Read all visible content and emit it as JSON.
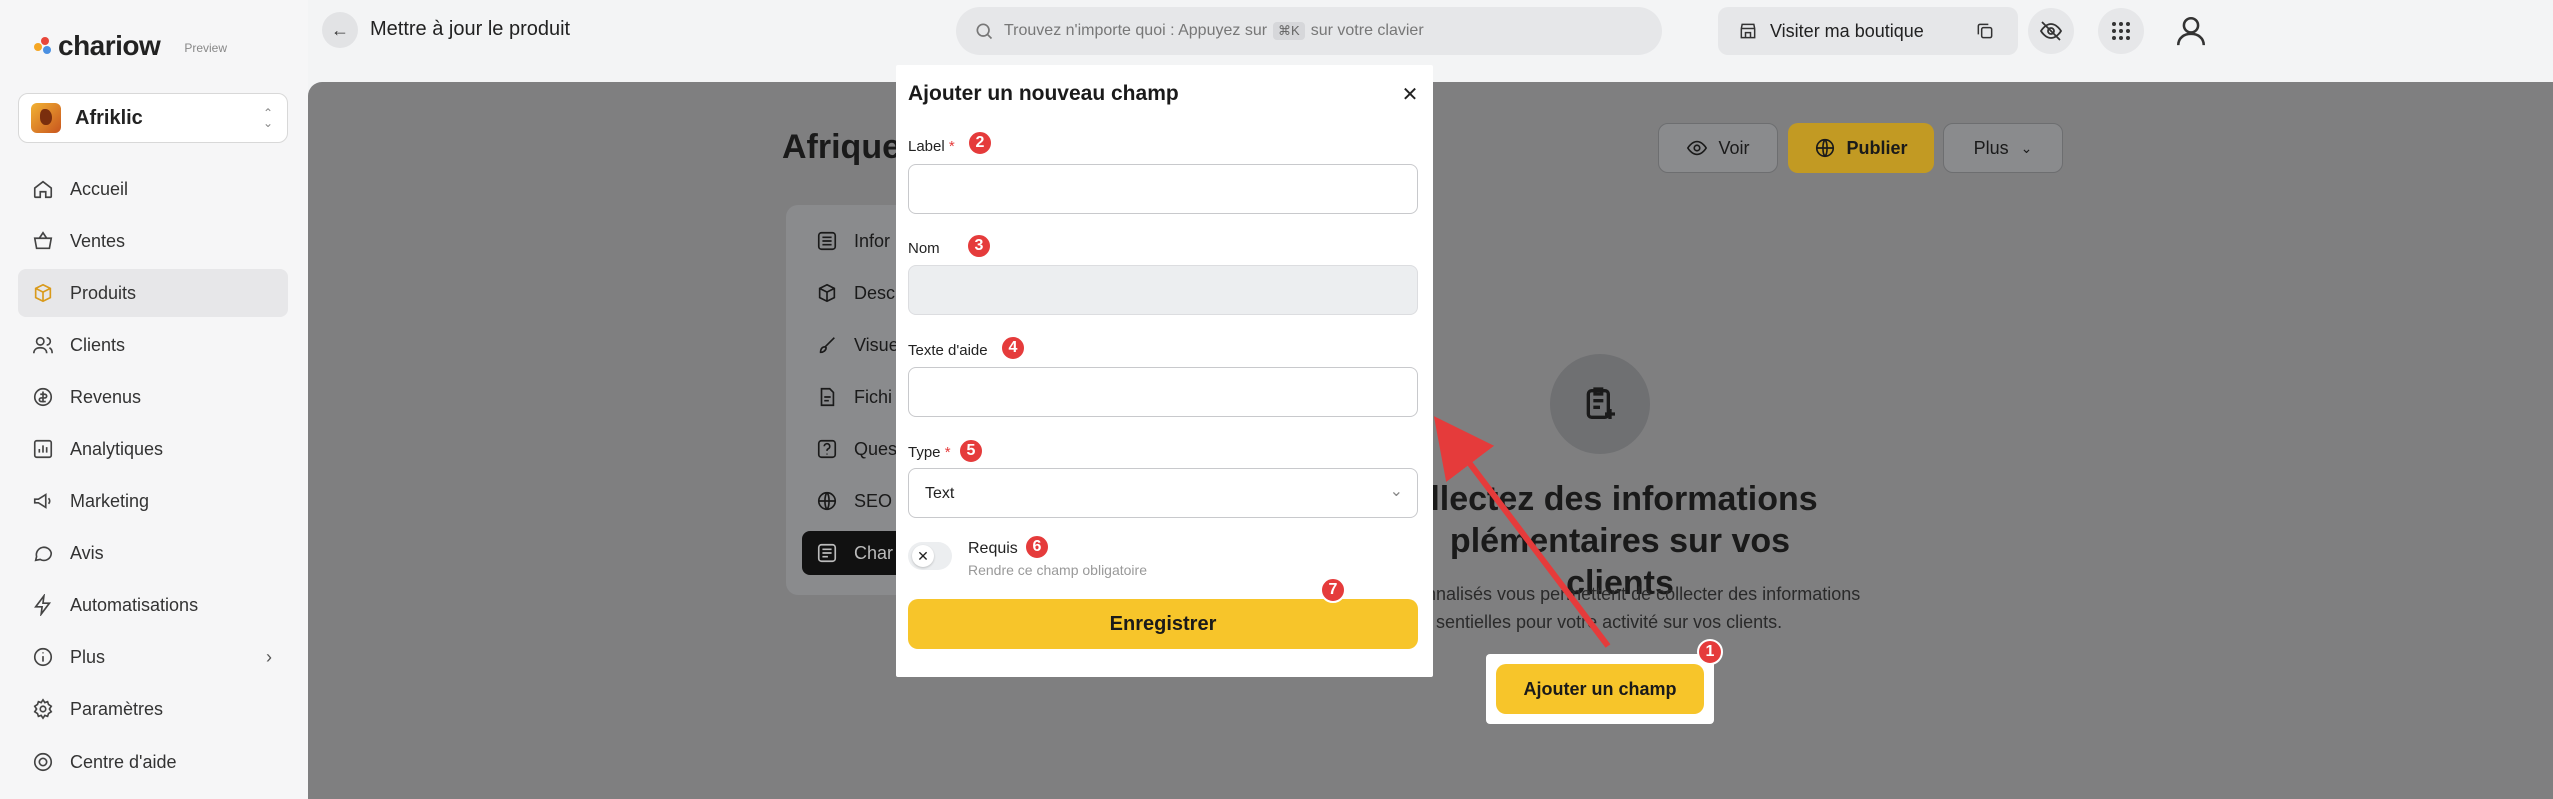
{
  "brand": {
    "name": "chariow",
    "tag": "Preview"
  },
  "store": {
    "name": "Afriklic"
  },
  "sidebar": {
    "items": [
      {
        "label": "Accueil",
        "icon": "home-icon"
      },
      {
        "label": "Ventes",
        "icon": "basket-icon"
      },
      {
        "label": "Produits",
        "icon": "box-icon",
        "active": true
      },
      {
        "label": "Clients",
        "icon": "users-icon"
      },
      {
        "label": "Revenus",
        "icon": "coin-icon"
      },
      {
        "label": "Analytiques",
        "icon": "chart-icon"
      },
      {
        "label": "Marketing",
        "icon": "megaphone-icon"
      },
      {
        "label": "Avis",
        "icon": "chat-icon"
      },
      {
        "label": "Automatisations",
        "icon": "bolt-icon"
      },
      {
        "label": "Plus",
        "icon": "info-icon"
      },
      {
        "label": "Paramètres",
        "icon": "gear-icon"
      }
    ],
    "help": "Centre d'aide"
  },
  "topbar": {
    "title": "Mettre à jour le produit",
    "search_prefix": "Trouvez n'importe quoi : Appuyez sur",
    "search_kbd": "⌘K",
    "search_suffix": "sur votre clavier",
    "visit_label": "Visiter ma boutique"
  },
  "product": {
    "title": "Afrique",
    "voir": "Voir",
    "publier": "Publier",
    "plus": "Plus"
  },
  "subnav": {
    "items": [
      {
        "label": "Infor"
      },
      {
        "label": "Desc"
      },
      {
        "label": "Visue"
      },
      {
        "label": "Fichi"
      },
      {
        "label": "Ques"
      },
      {
        "label": "SEO"
      },
      {
        "label": "Char",
        "active": true
      }
    ]
  },
  "empty_state": {
    "title_line1": "llectez des informations",
    "title_line2": "plémentaires sur vos clients",
    "desc_line1": "nnalisés vous permettent de collecter des informations",
    "desc_line2": "sentielles pour votre activité sur vos clients.",
    "button": "Ajouter un champ"
  },
  "modal": {
    "title": "Ajouter un nouveau champ",
    "label_field": "Label",
    "name_field": "Nom",
    "help_field": "Texte d'aide",
    "type_field": "Type",
    "type_value": "Text",
    "required_label": "Requis",
    "required_sub": "Rendre ce champ obligatoire",
    "save": "Enregistrer",
    "required_mark": "*"
  },
  "annotations": [
    "1",
    "2",
    "3",
    "4",
    "5",
    "6",
    "7"
  ],
  "colors": {
    "accent": "#f7c52a",
    "badge": "#e53b3b",
    "arrow": "#e53b3b"
  }
}
